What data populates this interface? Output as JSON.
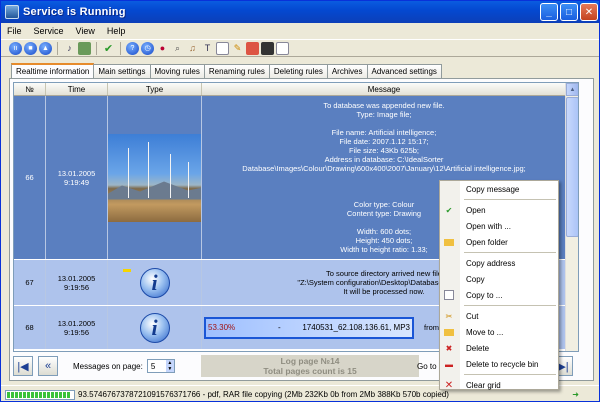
{
  "window": {
    "title": "Service is Running"
  },
  "menu": [
    "File",
    "Service",
    "View",
    "Help"
  ],
  "tabs": [
    {
      "label": "Realtime information",
      "active": true
    },
    {
      "label": "Main settings"
    },
    {
      "label": "Moving rules"
    },
    {
      "label": "Renaming rules"
    },
    {
      "label": "Deleting rules"
    },
    {
      "label": "Archives"
    },
    {
      "label": "Advanced settings"
    }
  ],
  "grid": {
    "columns": [
      "№",
      "Time",
      "Type",
      "Message"
    ],
    "rows": [
      {
        "num": "66",
        "date": "13.01.2005",
        "time": "9:19:49",
        "type": "image-thumbnail",
        "message": [
          "To database was appended new file.",
          "Type: Image file;",
          "",
          "File name:  Artificial intelligence;",
          "File date:  2007.1.12 15:17;",
          "File size:  43Kb 625b;",
          "Address in database:  C:\\IdealSorter",
          "Database\\Images\\Colour\\Drawing\\600x400\\2007\\January\\12\\Artificial intelligence.jpg;",
          "",
          "",
          "",
          "Color type:  Colour",
          "Content type:  Drawing",
          "",
          "Width:  600 dots;",
          "Height:  450 dots;",
          "Width to height ratio:  1.33;"
        ]
      },
      {
        "num": "67",
        "date": "13.01.2005",
        "time": "9:19:56",
        "type": "info-icon",
        "message": [
          "To source directory arrived new file",
          "\"Z:\\System configuration\\Desktop\\Database\\New Fo",
          "It will be processed now."
        ]
      },
      {
        "num": "68",
        "date": "13.01.2005",
        "time": "9:19:56",
        "type": "info-icon",
        "progress": {
          "percent_text": "53.30%",
          "value": 53.3,
          "sep": "-",
          "file": "1740531_62.108.136.61, MP3",
          "from": "from"
        }
      }
    ]
  },
  "footer": {
    "messages_label": "Messages on page:",
    "messages_value": "5",
    "log_page": "Log page №14",
    "total_pages": "Total pages count is 15",
    "goto_label": "Go to p"
  },
  "status": {
    "text": "93.5746767378721091576371766 - pdf, RAR file copying (2Mb 232Kb 0b  from  2Mb 388Kb 570b copied)"
  },
  "context_menu": [
    {
      "label": "Copy message",
      "icon": ""
    },
    {
      "sep": true
    },
    {
      "label": "Open",
      "icon": "check-icon"
    },
    {
      "label": "Open with ...",
      "icon": ""
    },
    {
      "label": "Open folder",
      "icon": "folder-icon"
    },
    {
      "sep": true
    },
    {
      "label": "Copy address",
      "icon": ""
    },
    {
      "label": "Copy",
      "icon": ""
    },
    {
      "label": "Copy to ...",
      "icon": "copy-icon"
    },
    {
      "sep": true
    },
    {
      "label": "Cut",
      "icon": "scissors-icon"
    },
    {
      "label": "Move to ...",
      "icon": "folder-move-icon"
    },
    {
      "label": "Delete",
      "icon": "delete-icon"
    },
    {
      "label": "Delete to recycle bin",
      "icon": "recycle-icon"
    },
    {
      "sep": true
    },
    {
      "label": "Clear grid",
      "icon": "x-icon"
    }
  ]
}
